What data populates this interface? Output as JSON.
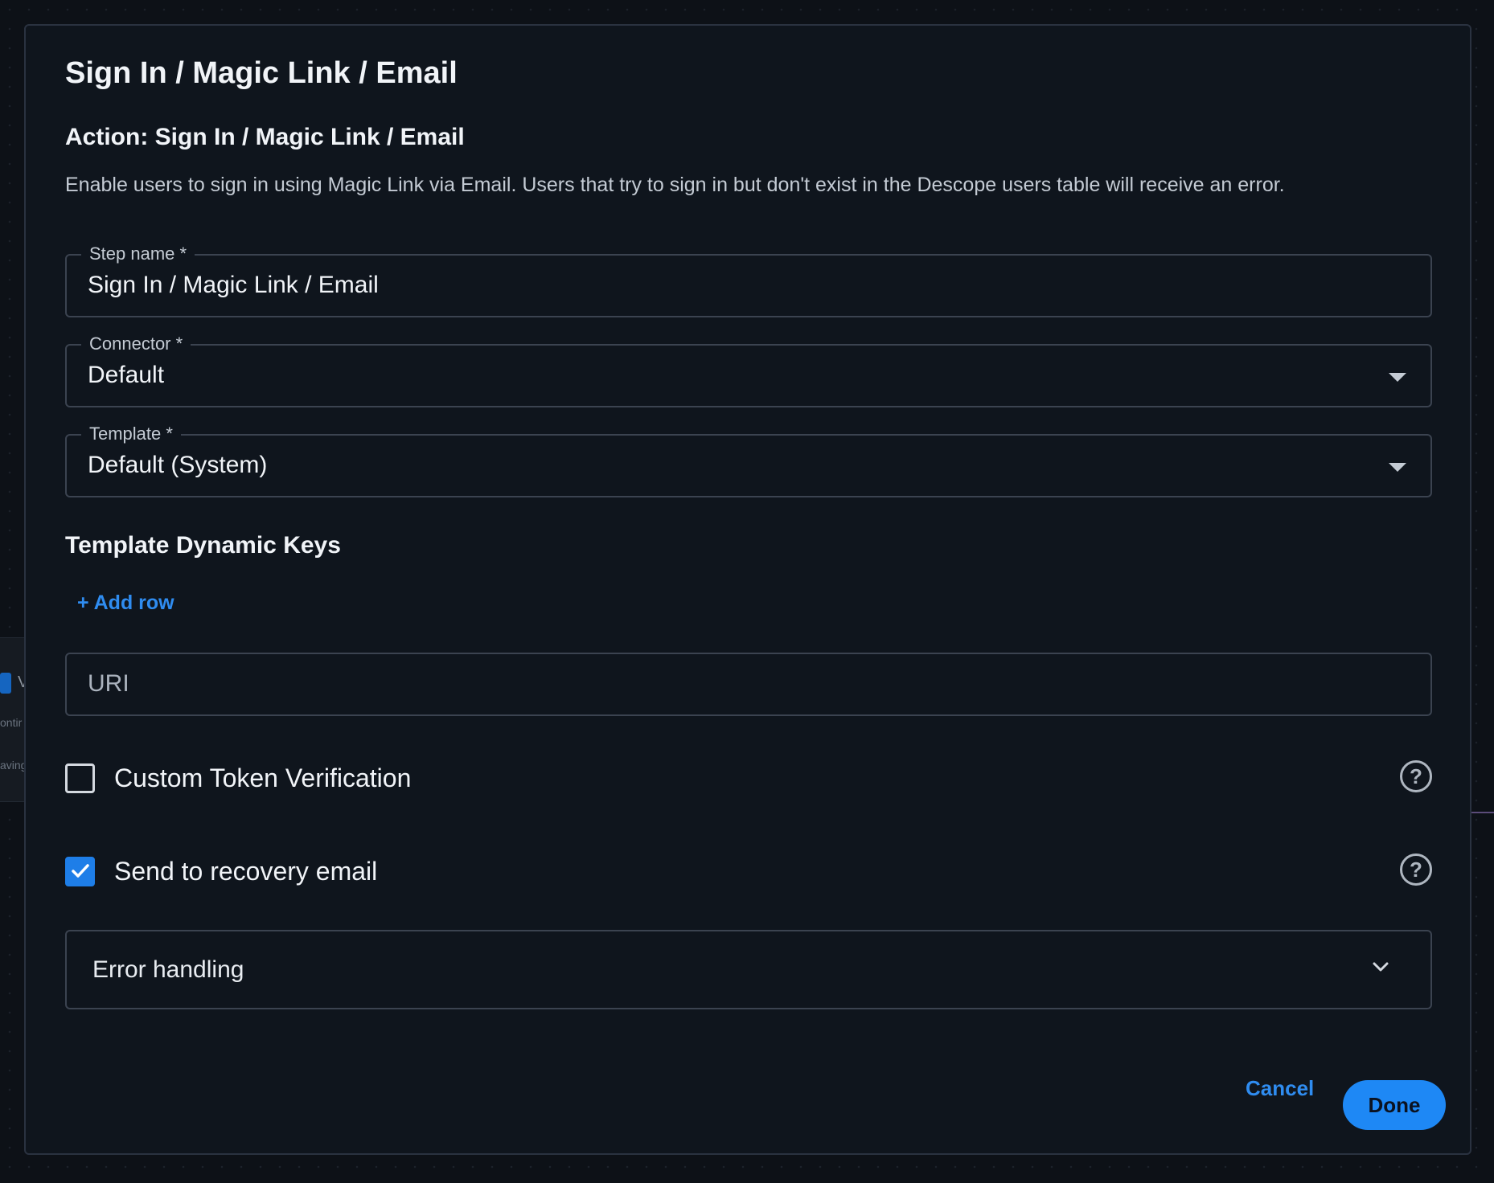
{
  "background_fragments": {
    "left_labels": [
      "ontir",
      "aving"
    ],
    "left_initial": "V"
  },
  "dialog": {
    "title": "Sign In / Magic Link / Email",
    "action_title": "Action: Sign In / Magic Link / Email",
    "description": "Enable users to sign in using Magic Link via Email. Users that try to sign in but don't exist in the Descope users table will receive an error."
  },
  "fields": {
    "step_name": {
      "label": "Step name *",
      "value": "Sign In / Magic Link / Email"
    },
    "connector": {
      "label": "Connector *",
      "value": "Default"
    },
    "template": {
      "label": "Template *",
      "value": "Default (System)"
    }
  },
  "dynamic_keys": {
    "heading": "Template Dynamic Keys",
    "add_row_label": "+ Add row",
    "uri_placeholder": "URI"
  },
  "options": {
    "custom_token": {
      "label": "Custom Token Verification",
      "checked": false
    },
    "recovery_email": {
      "label": "Send to recovery email",
      "checked": true
    },
    "help_glyph": "?"
  },
  "error_handling": {
    "label": "Error handling"
  },
  "footer": {
    "cancel_label": "Cancel",
    "done_label": "Done"
  },
  "colors": {
    "accent": "#1e88f5",
    "link": "#2f8cf0",
    "dialog_bg": "#0f151d",
    "border": "#3b4350"
  },
  "icons": {
    "dropdown": "caret-down-icon",
    "accordion": "chevron-down-icon",
    "help": "question-circle-icon",
    "checkmark": "checkmark-icon"
  }
}
